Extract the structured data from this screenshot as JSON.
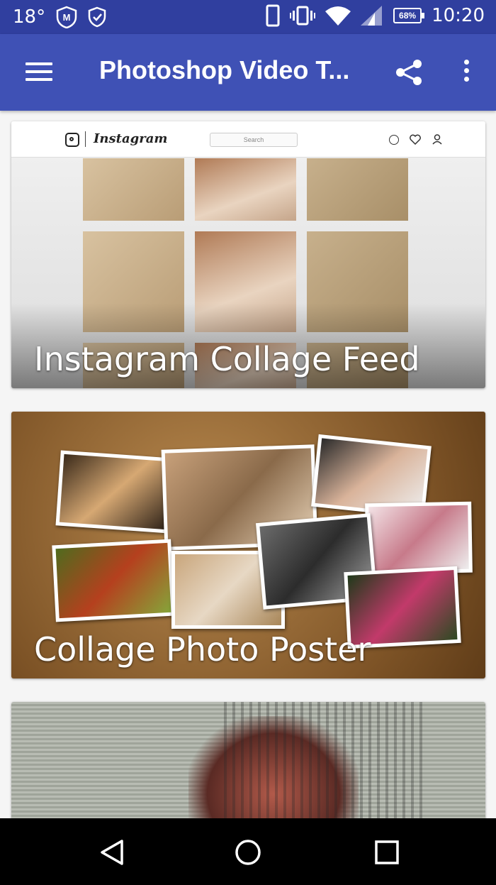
{
  "status_bar": {
    "temperature": "18°",
    "battery": "68%",
    "time": "10:20"
  },
  "app_bar": {
    "title": "Photoshop Video T..."
  },
  "cards": [
    {
      "caption": "Instagram Collage Feed",
      "ig_header": {
        "wordmark": "Instagram",
        "search_placeholder": "Search"
      }
    },
    {
      "caption": "Collage Photo Poster"
    },
    {
      "caption": ""
    }
  ],
  "nav_bar": {
    "buttons": [
      "back",
      "home",
      "recents"
    ]
  }
}
